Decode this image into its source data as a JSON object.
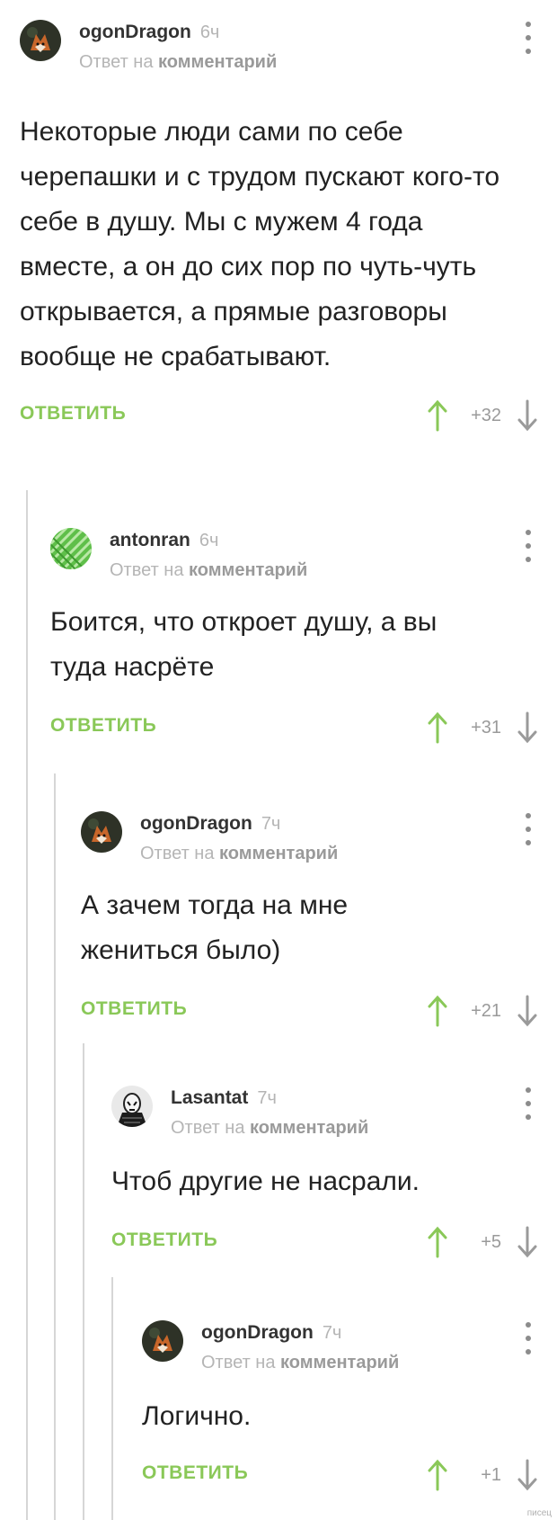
{
  "comments": [
    {
      "author": "ogonDragon",
      "time": "6ч",
      "reply_prefix": "Ответ на",
      "reply_target": "комментарий",
      "text": "Некоторые люди сами по себе черепашки и с трудом пускают кого-то себе в душу. Мы с мужем 4 года вместе, а он до сих пор по чуть-чуть открывается, а прямые разговоры вообще не срабатывают.",
      "reply_label": "ОТВЕТИТЬ",
      "score": "+32",
      "avatar_icon": "fox-avatar-icon"
    },
    {
      "author": "antonran",
      "time": "6ч",
      "reply_prefix": "Ответ на",
      "reply_target": "комментарий",
      "text": "Боится, что откроет душу, а вы туда насрёте",
      "reply_label": "ОТВЕТИТЬ",
      "score": "+31",
      "avatar_icon": "green-pattern-avatar-icon"
    },
    {
      "author": "ogonDragon",
      "time": "7ч",
      "reply_prefix": "Ответ на",
      "reply_target": "комментарий",
      "text": "А зачем тогда на мне жениться было)",
      "reply_label": "ОТВЕТИТЬ",
      "score": "+21",
      "avatar_icon": "fox-avatar-icon"
    },
    {
      "author": "Lasantat",
      "time": "7ч",
      "reply_prefix": "Ответ на",
      "reply_target": "комментарий",
      "text": "Чтоб другие не насрали.",
      "reply_label": "ОТВЕТИТЬ",
      "score": "+5",
      "avatar_icon": "masked-figure-avatar-icon"
    },
    {
      "author": "ogonDragon",
      "time": "7ч",
      "reply_prefix": "Ответ на",
      "reply_target": "комментарий",
      "text": "Логично.",
      "reply_label": "ОТВЕТИТЬ",
      "score": "+1",
      "avatar_icon": "fox-avatar-icon"
    }
  ],
  "colors": {
    "accent": "#8ac858",
    "muted": "#b5b5b5",
    "thread_line": "#d6d6d6"
  },
  "watermark": "писец"
}
